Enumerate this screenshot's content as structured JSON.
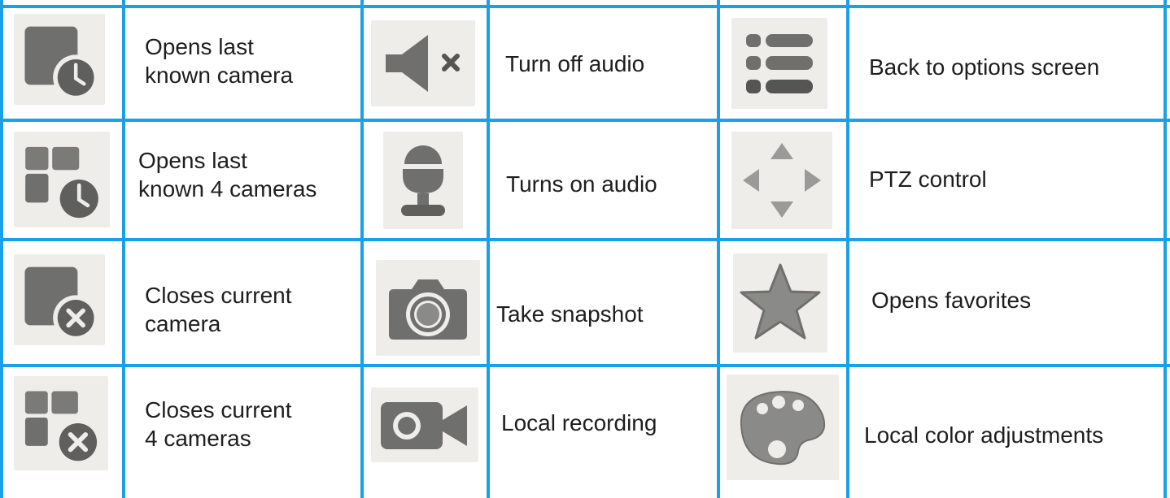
{
  "legend": {
    "rows": [
      [
        {
          "icon": "last-camera-clock-icon",
          "lines": [
            "Opens last",
            "known camera"
          ]
        },
        {
          "icon": "speaker-mute-icon",
          "lines": [
            "Turn off audio"
          ]
        },
        {
          "icon": "options-list-icon",
          "lines": [
            "Back to options screen"
          ]
        }
      ],
      [
        {
          "icon": "four-cameras-clock-icon",
          "lines": [
            "Opens last",
            "known 4 cameras"
          ]
        },
        {
          "icon": "microphone-icon",
          "lines": [
            "Turns on audio"
          ]
        },
        {
          "icon": "ptz-arrows-icon",
          "lines": [
            "PTZ control"
          ]
        }
      ],
      [
        {
          "icon": "close-camera-icon",
          "lines": [
            "Closes current",
            "camera"
          ]
        },
        {
          "icon": "camera-icon",
          "lines": [
            "Take snapshot"
          ]
        },
        {
          "icon": "star-icon",
          "lines": [
            "Opens favorites"
          ]
        }
      ],
      [
        {
          "icon": "close-four-cameras-icon",
          "lines": [
            "Closes current",
            "4 cameras"
          ]
        },
        {
          "icon": "video-camera-icon",
          "lines": [
            "Local recording"
          ]
        },
        {
          "icon": "palette-icon",
          "lines": [
            "Local color adjustments"
          ]
        }
      ]
    ]
  },
  "colors": {
    "grid_line": "#1aa0e6",
    "tile_background": "#efedea",
    "icon_gray": "#6f6f6d",
    "text": "#1e1e1e"
  }
}
